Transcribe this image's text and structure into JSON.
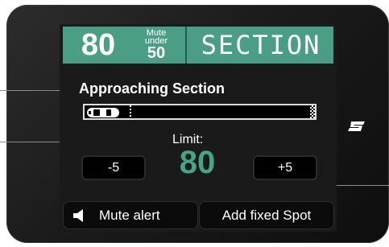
{
  "header": {
    "speed": "80",
    "mute_under_line1": "Mute",
    "mute_under_line2": "under",
    "mute_under_value": "50",
    "section_label": "SECTION"
  },
  "status": {
    "approaching": "Approaching Section"
  },
  "limit": {
    "label": "Limit:",
    "value": "80"
  },
  "controls": {
    "minus_label": "-5",
    "plus_label": "+5"
  },
  "bottom": {
    "mute_label": "Mute alert",
    "spot_label": "Add fixed Spot"
  },
  "colors": {
    "accent": "#4a9e86",
    "limit_text": "#46a489",
    "background": "#1a1a1a"
  },
  "icons": {
    "speaker": "speaker-icon",
    "car": "car-icon",
    "logo": "brand-logo-icon"
  }
}
